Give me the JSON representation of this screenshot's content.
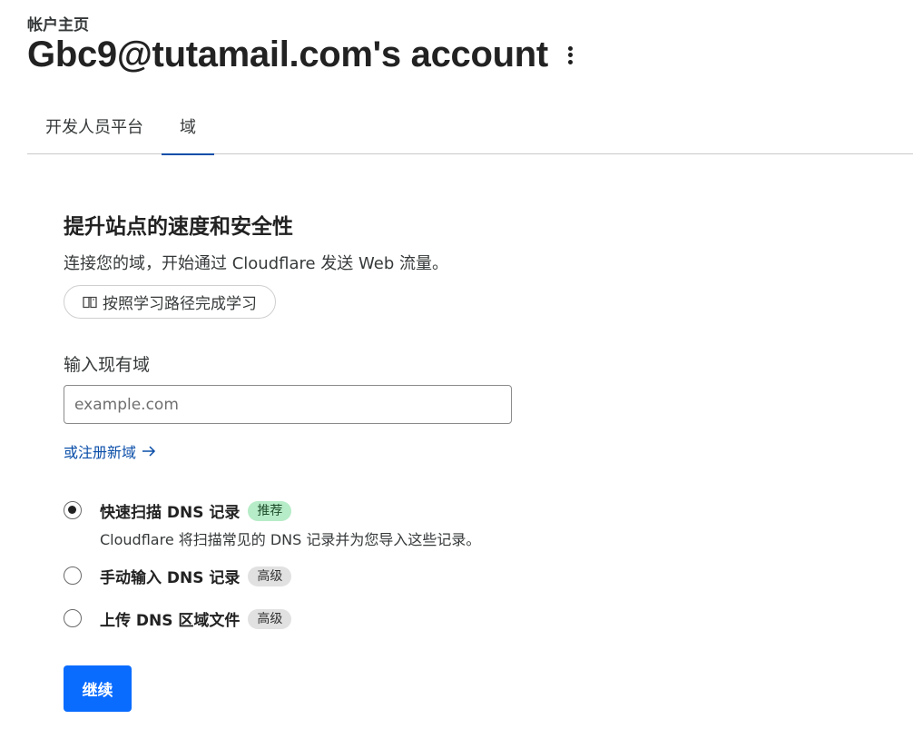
{
  "header": {
    "breadcrumb": "帐户主页",
    "title": "Gbc9@tutamail.com's account",
    "more_icon": "vertical-ellipsis-icon"
  },
  "tabs": [
    {
      "label": "开发人员平台",
      "active": false
    },
    {
      "label": "域",
      "active": true
    }
  ],
  "main": {
    "section_title": "提升站点的速度和安全性",
    "section_desc": "连接您的域，开始通过 Cloudflare 发送 Web 流量。",
    "learn_button": {
      "icon": "book-icon",
      "label": "按照学习路径完成学习"
    },
    "domain_field": {
      "label": "输入现有域",
      "placeholder": "example.com",
      "value": ""
    },
    "register_link": {
      "label": "或注册新域",
      "icon": "arrow-right-icon"
    },
    "scan_options": [
      {
        "title": "快速扫描 DNS 记录",
        "badge": "推荐",
        "desc": "Cloudflare 将扫描常见的 DNS 记录并为您导入这些记录。",
        "checked": true
      },
      {
        "title": "手动输入 DNS 记录",
        "badge": "高级",
        "desc": "",
        "checked": false
      },
      {
        "title": "上传 DNS 区域文件",
        "badge": "高级",
        "desc": "",
        "checked": false
      }
    ],
    "continue_button": "继续"
  },
  "colors": {
    "accent": "#0a6cff",
    "link": "#0a4ea8",
    "badge_recommended_bg": "#b6ecc7",
    "badge_advanced_bg": "#e1e1e1"
  }
}
